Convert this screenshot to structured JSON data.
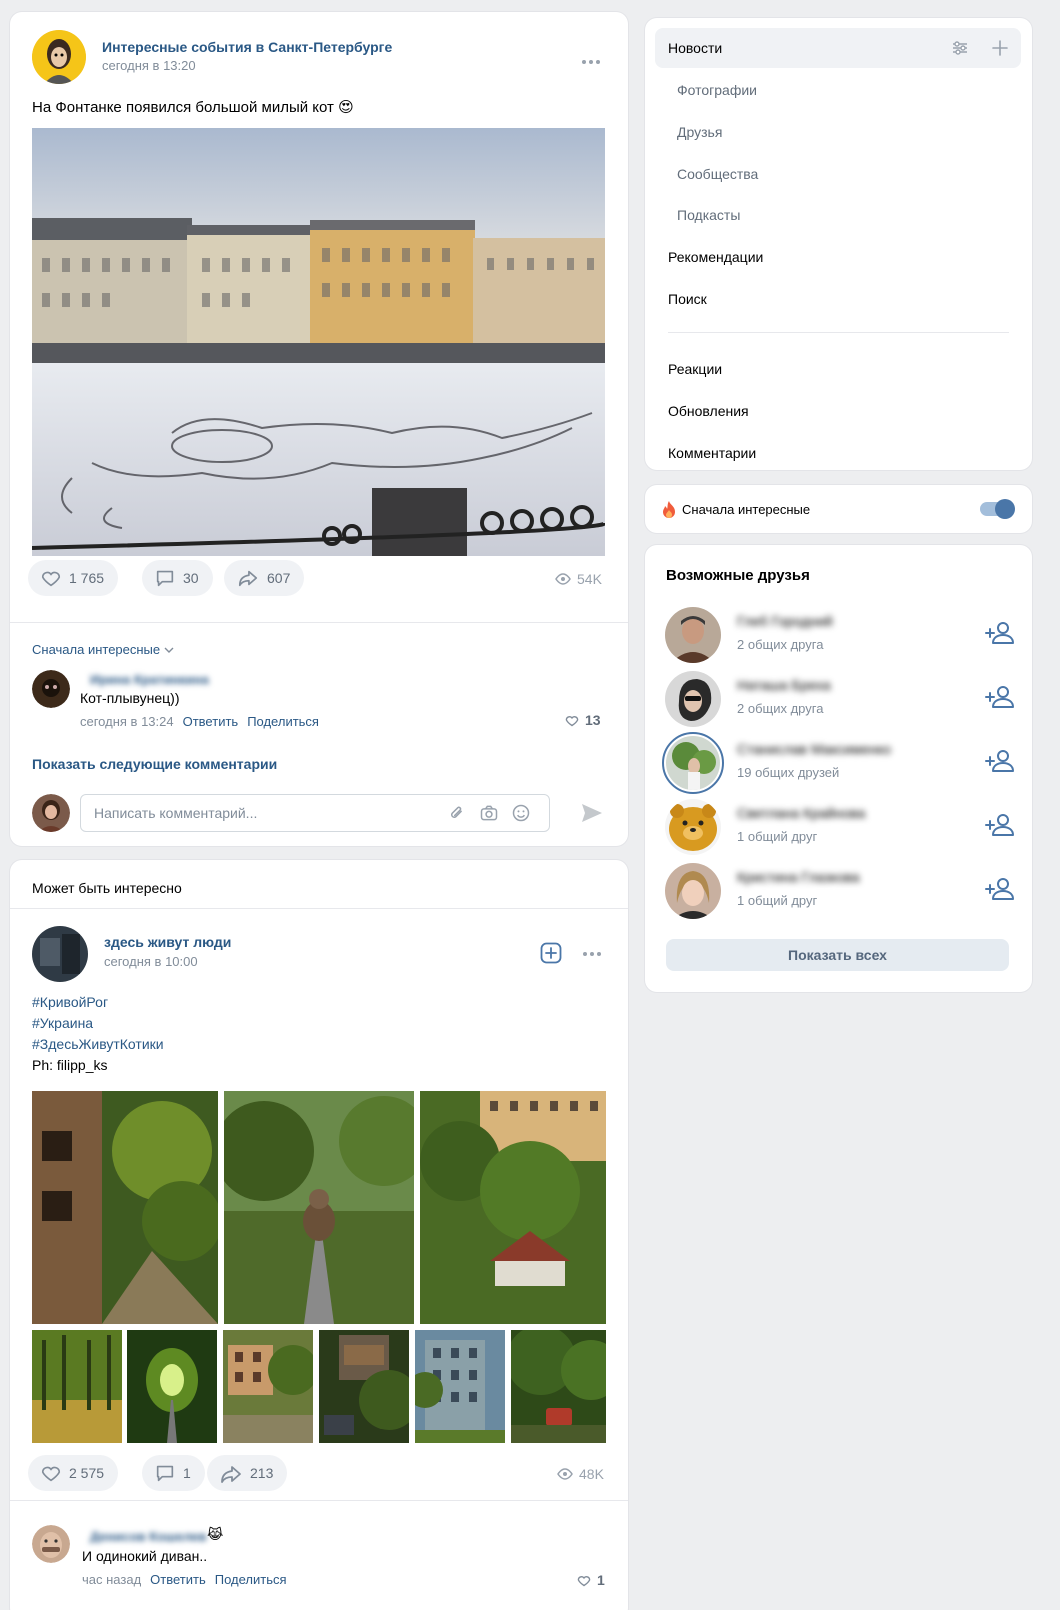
{
  "post1": {
    "author": "Интересные события в Санкт-Петербурге",
    "time": "сегодня в 13:20",
    "text": "На Фонтанке появился большой милый кот",
    "emoji": "😍",
    "likes": "1 765",
    "comments": "30",
    "shares": "607",
    "views": "54K",
    "sort_label": "Сначала интересные",
    "comment": {
      "author": "Ирина Кратинкина",
      "text": "Кот-плывунец))",
      "time": "сегодня в 13:24",
      "reply": "Ответить",
      "share": "Поделиться",
      "likes": "13"
    },
    "show_more": "Показать следующие комментарии",
    "comment_placeholder": "Написать комментарий..."
  },
  "post2": {
    "section_title": "Может быть интересно",
    "author": "здесь живут люди",
    "time": "сегодня в 10:00",
    "hashtags": [
      "#КривойРог",
      "#Украина",
      "#ЗдесьЖивутКотики"
    ],
    "credit": "Ph: filipp_ks",
    "likes": "2 575",
    "comments": "1",
    "shares": "213",
    "views": "48K",
    "comment": {
      "author": "Денисов Кошелев",
      "emoji": "😹",
      "text": "И одинокий диван..",
      "time": "час назад",
      "reply": "Ответить",
      "share": "Поделиться",
      "likes": "1"
    }
  },
  "menu": {
    "items": [
      {
        "label": "Новости"
      },
      {
        "label": "Фотографии"
      },
      {
        "label": "Друзья"
      },
      {
        "label": "Сообщества"
      },
      {
        "label": "Подкасты"
      },
      {
        "label": "Рекомендации"
      },
      {
        "label": "Поиск"
      },
      {
        "label": "Реакции"
      },
      {
        "label": "Обновления"
      },
      {
        "label": "Комментарии"
      }
    ]
  },
  "toggle": {
    "label": "Сначала интересные",
    "on": true
  },
  "friends": {
    "title": "Возможные друзья",
    "list": [
      {
        "name": "Глеб Городний",
        "mutual": "2 общих друга"
      },
      {
        "name": "Наташа Бреха",
        "mutual": "2 общих друга"
      },
      {
        "name": "Станислав Максименко",
        "mutual": "19 общих друзей"
      },
      {
        "name": "Светлана Крайнова",
        "mutual": "1 общий друг"
      },
      {
        "name": "Кристина Глазкова",
        "mutual": "1 общий друг"
      }
    ],
    "show_all": "Показать всех"
  },
  "colors": {
    "link": "#2a5885",
    "accent": "#4a76a8",
    "background": "#edeef0"
  }
}
